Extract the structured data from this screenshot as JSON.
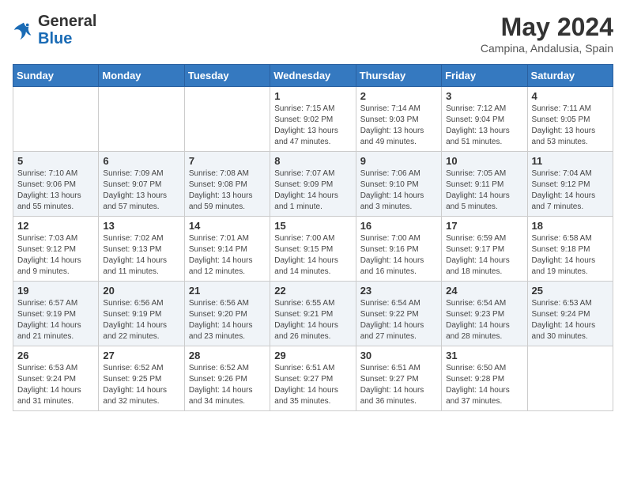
{
  "header": {
    "logo_general": "General",
    "logo_blue": "Blue",
    "title": "May 2024",
    "subtitle": "Campina, Andalusia, Spain"
  },
  "calendar": {
    "days_of_week": [
      "Sunday",
      "Monday",
      "Tuesday",
      "Wednesday",
      "Thursday",
      "Friday",
      "Saturday"
    ],
    "weeks": [
      [
        {
          "day": "",
          "info": ""
        },
        {
          "day": "",
          "info": ""
        },
        {
          "day": "",
          "info": ""
        },
        {
          "day": "1",
          "info": "Sunrise: 7:15 AM\nSunset: 9:02 PM\nDaylight: 13 hours and 47 minutes."
        },
        {
          "day": "2",
          "info": "Sunrise: 7:14 AM\nSunset: 9:03 PM\nDaylight: 13 hours and 49 minutes."
        },
        {
          "day": "3",
          "info": "Sunrise: 7:12 AM\nSunset: 9:04 PM\nDaylight: 13 hours and 51 minutes."
        },
        {
          "day": "4",
          "info": "Sunrise: 7:11 AM\nSunset: 9:05 PM\nDaylight: 13 hours and 53 minutes."
        }
      ],
      [
        {
          "day": "5",
          "info": "Sunrise: 7:10 AM\nSunset: 9:06 PM\nDaylight: 13 hours and 55 minutes."
        },
        {
          "day": "6",
          "info": "Sunrise: 7:09 AM\nSunset: 9:07 PM\nDaylight: 13 hours and 57 minutes."
        },
        {
          "day": "7",
          "info": "Sunrise: 7:08 AM\nSunset: 9:08 PM\nDaylight: 13 hours and 59 minutes."
        },
        {
          "day": "8",
          "info": "Sunrise: 7:07 AM\nSunset: 9:09 PM\nDaylight: 14 hours and 1 minute."
        },
        {
          "day": "9",
          "info": "Sunrise: 7:06 AM\nSunset: 9:10 PM\nDaylight: 14 hours and 3 minutes."
        },
        {
          "day": "10",
          "info": "Sunrise: 7:05 AM\nSunset: 9:11 PM\nDaylight: 14 hours and 5 minutes."
        },
        {
          "day": "11",
          "info": "Sunrise: 7:04 AM\nSunset: 9:12 PM\nDaylight: 14 hours and 7 minutes."
        }
      ],
      [
        {
          "day": "12",
          "info": "Sunrise: 7:03 AM\nSunset: 9:12 PM\nDaylight: 14 hours and 9 minutes."
        },
        {
          "day": "13",
          "info": "Sunrise: 7:02 AM\nSunset: 9:13 PM\nDaylight: 14 hours and 11 minutes."
        },
        {
          "day": "14",
          "info": "Sunrise: 7:01 AM\nSunset: 9:14 PM\nDaylight: 14 hours and 12 minutes."
        },
        {
          "day": "15",
          "info": "Sunrise: 7:00 AM\nSunset: 9:15 PM\nDaylight: 14 hours and 14 minutes."
        },
        {
          "day": "16",
          "info": "Sunrise: 7:00 AM\nSunset: 9:16 PM\nDaylight: 14 hours and 16 minutes."
        },
        {
          "day": "17",
          "info": "Sunrise: 6:59 AM\nSunset: 9:17 PM\nDaylight: 14 hours and 18 minutes."
        },
        {
          "day": "18",
          "info": "Sunrise: 6:58 AM\nSunset: 9:18 PM\nDaylight: 14 hours and 19 minutes."
        }
      ],
      [
        {
          "day": "19",
          "info": "Sunrise: 6:57 AM\nSunset: 9:19 PM\nDaylight: 14 hours and 21 minutes."
        },
        {
          "day": "20",
          "info": "Sunrise: 6:56 AM\nSunset: 9:19 PM\nDaylight: 14 hours and 22 minutes."
        },
        {
          "day": "21",
          "info": "Sunrise: 6:56 AM\nSunset: 9:20 PM\nDaylight: 14 hours and 23 minutes."
        },
        {
          "day": "22",
          "info": "Sunrise: 6:55 AM\nSunset: 9:21 PM\nDaylight: 14 hours and 26 minutes."
        },
        {
          "day": "23",
          "info": "Sunrise: 6:54 AM\nSunset: 9:22 PM\nDaylight: 14 hours and 27 minutes."
        },
        {
          "day": "24",
          "info": "Sunrise: 6:54 AM\nSunset: 9:23 PM\nDaylight: 14 hours and 28 minutes."
        },
        {
          "day": "25",
          "info": "Sunrise: 6:53 AM\nSunset: 9:24 PM\nDaylight: 14 hours and 30 minutes."
        }
      ],
      [
        {
          "day": "26",
          "info": "Sunrise: 6:53 AM\nSunset: 9:24 PM\nDaylight: 14 hours and 31 minutes."
        },
        {
          "day": "27",
          "info": "Sunrise: 6:52 AM\nSunset: 9:25 PM\nDaylight: 14 hours and 32 minutes."
        },
        {
          "day": "28",
          "info": "Sunrise: 6:52 AM\nSunset: 9:26 PM\nDaylight: 14 hours and 34 minutes."
        },
        {
          "day": "29",
          "info": "Sunrise: 6:51 AM\nSunset: 9:27 PM\nDaylight: 14 hours and 35 minutes."
        },
        {
          "day": "30",
          "info": "Sunrise: 6:51 AM\nSunset: 9:27 PM\nDaylight: 14 hours and 36 minutes."
        },
        {
          "day": "31",
          "info": "Sunrise: 6:50 AM\nSunset: 9:28 PM\nDaylight: 14 hours and 37 minutes."
        },
        {
          "day": "",
          "info": ""
        }
      ]
    ]
  }
}
